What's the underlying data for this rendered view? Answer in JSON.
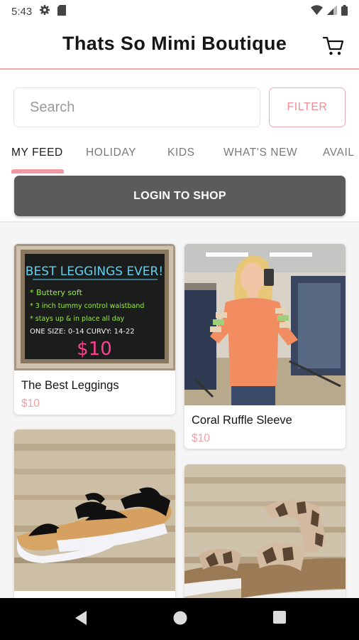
{
  "status": {
    "time": "5:43"
  },
  "header": {
    "title": "Thats So Mimi Boutique"
  },
  "search": {
    "placeholder": "Search"
  },
  "filter": {
    "label": "FILTER"
  },
  "tabs": [
    {
      "label": "MY FEED",
      "active": true
    },
    {
      "label": "HOLIDAY",
      "active": false
    },
    {
      "label": "KIDS",
      "active": false
    },
    {
      "label": "WHAT'S NEW",
      "active": false
    },
    {
      "label": "AVAIL",
      "active": false
    }
  ],
  "login": {
    "label": "LOGIN TO SHOP"
  },
  "products": [
    {
      "name": "The Best Leggings",
      "price": "$10",
      "image": "chalkboard-sign",
      "sign": {
        "title": "BEST LEGGINGS EVER!",
        "lines": [
          "* Buttery soft",
          "* 3 inch tummy control waistband",
          "* stays up & in place all day"
        ],
        "sizes": "ONE SIZE: 0-14   CURVY: 14-22",
        "price": "$10"
      }
    },
    {
      "name": "Coral Ruffle Sleeve",
      "price": "$10",
      "image": "woman-coral-top"
    },
    {
      "name": "",
      "price": "",
      "image": "black-platform-sandals"
    },
    {
      "name": "",
      "price": "",
      "image": "woven-wedge-sandals"
    }
  ],
  "colors": {
    "accent": "#ef8e98",
    "price": "#f0a0a8",
    "login_bg": "#5b5b5b",
    "chalkboard": "#1b1d1c"
  },
  "icons": [
    "settings-icon",
    "sd-card-icon",
    "wifi-icon",
    "signal-icon",
    "battery-icon",
    "cart-icon",
    "back-icon",
    "home-icon",
    "recents-icon"
  ]
}
